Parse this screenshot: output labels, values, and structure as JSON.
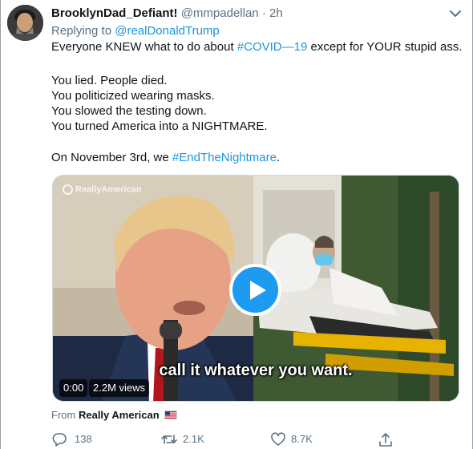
{
  "tweet": {
    "display_name": "BrooklynDad_Defiant!",
    "handle": "@mmpadellan",
    "separator": "·",
    "time": "2h",
    "replying_prefix": "Replying to",
    "replying_to": "@realDonaldTrump",
    "line1_pre": "Everyone KNEW what to do about ",
    "line1_hashtag": "#COVID—19",
    "line1_post": " except for YOUR stupid ass.",
    "line2": "You lied. People died.",
    "line3": "You politicized wearing masks.",
    "line4": "You slowed the testing down.",
    "line5": "You turned America into a NIGHTMARE.",
    "line6_pre": "On November 3rd, we ",
    "line6_hashtag": "#EndTheNightmare",
    "line6_post": "."
  },
  "media": {
    "watermark": "ReallyAmerican",
    "caption": "call it whatever you want.",
    "time_display": "0:00",
    "views": "2.2M views"
  },
  "source": {
    "prefix": "From",
    "name": "Really American"
  },
  "actions": {
    "reply_count": "138",
    "retweet_count": "2.1K",
    "like_count": "8.7K"
  },
  "colors": {
    "link": "#1b95e0",
    "muted": "#5b7083",
    "play": "#1d9bf0"
  },
  "icons": [
    "more-caret-icon",
    "reply-icon",
    "retweet-icon",
    "like-icon",
    "share-icon",
    "play-icon",
    "us-flag-icon"
  ]
}
